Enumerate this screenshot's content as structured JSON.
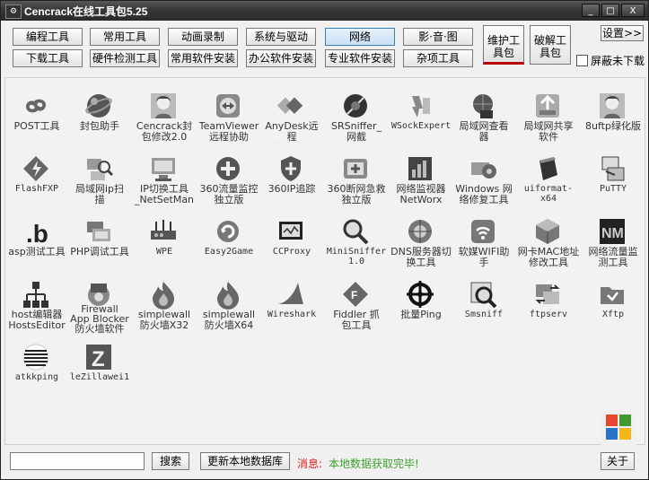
{
  "window": {
    "title": "Cencrack在线工具包5.25",
    "min": "_",
    "max": "□",
    "close": "X"
  },
  "toolbar": {
    "row1": [
      "编程工具",
      "常用工具",
      "动画录制",
      "系统与驱动",
      "网络",
      "影·音·图"
    ],
    "row2": [
      "下载工具",
      "硬件检测工具",
      "常用软件安装",
      "办公软件安装",
      "专业软件安装",
      "杂项工具"
    ],
    "big": [
      "维护工\n具包",
      "破解工\n具包"
    ],
    "settings": "设置>>",
    "hide_checkbox_label": "屏蔽未下载"
  },
  "items": [
    {
      "label": "POST工具",
      "icon": "link-icon"
    },
    {
      "label": "封包助手",
      "icon": "orb-icon"
    },
    {
      "label": "Cencrack封\n包修改2.0",
      "icon": "avatar-icon"
    },
    {
      "label": "TeamViewer\n远程协助",
      "icon": "teamviewer-icon"
    },
    {
      "label": "AnyDesk远程\n协助软件",
      "icon": "anydesk-icon"
    },
    {
      "label": "SRSniffer_\n网截",
      "icon": "sniffer-icon"
    },
    {
      "label": "WSockExpert",
      "icon": "wsock-icon"
    },
    {
      "label": "局域网查看\n器",
      "icon": "lan-icon"
    },
    {
      "label": "局域网共享\n软件",
      "icon": "share-icon"
    },
    {
      "label": "8uftp绿化版",
      "icon": "avatar-icon"
    },
    {
      "label": "FlashFXP",
      "icon": "flashfxp-icon"
    },
    {
      "label": "局域网ip扫\n描",
      "icon": "ipscan-icon"
    },
    {
      "label": "IP切换工具\n_NetSetMan",
      "icon": "netsetman-icon"
    },
    {
      "label": "360流量监控\n独立版",
      "icon": "plus-icon"
    },
    {
      "label": "360IP追踪",
      "icon": "shield-icon"
    },
    {
      "label": "360断网急救\n独立版",
      "icon": "firstaid-icon"
    },
    {
      "label": "网络监视器\nNetWorx",
      "icon": "chart-icon"
    },
    {
      "label": "Windows 网\n络修复工具",
      "icon": "repair-icon"
    },
    {
      "label": "uiformat-x64",
      "icon": "cylinder-icon"
    },
    {
      "label": "PuTTY",
      "icon": "putty-icon"
    },
    {
      "label": "asp测试工具",
      "icon": "b-icon"
    },
    {
      "label": "PHP调试工具",
      "icon": "server-icon"
    },
    {
      "label": "WPE",
      "icon": "router-icon"
    },
    {
      "label": "Easy2Game",
      "icon": "refresh-icon"
    },
    {
      "label": "CCProxy",
      "icon": "monitor-icon"
    },
    {
      "label": "MiniSniffer\n1.0",
      "icon": "magnifier-icon"
    },
    {
      "label": "DNS服务器切\n换工具",
      "icon": "dns-icon"
    },
    {
      "label": "软媒WIFI助\n手",
      "icon": "wifi-icon"
    },
    {
      "label": "网卡MAC地址\n修改工具",
      "icon": "cube-icon"
    },
    {
      "label": "网络流量监\n测工具",
      "icon": "nm-icon"
    },
    {
      "label": "host编辑器\nHostsEditor",
      "icon": "network-tree-icon"
    },
    {
      "label": "Firewall\nApp Blocker\n防火墙软件",
      "icon": "firewall-icon"
    },
    {
      "label": "simplewall\n防火墙X32",
      "icon": "flame-icon"
    },
    {
      "label": "simplewall\n防火墙X64",
      "icon": "flame-icon"
    },
    {
      "label": "Wireshark",
      "icon": "fin-icon"
    },
    {
      "label": "Fiddler 抓\n包工具",
      "icon": "fiddler-icon"
    },
    {
      "label": "批量Ping",
      "icon": "crosshair-icon"
    },
    {
      "label": "Smsniff",
      "icon": "smsniff-icon"
    },
    {
      "label": "ftpserv",
      "icon": "ftpserv-icon"
    },
    {
      "label": "Xftp",
      "icon": "xftp-icon"
    },
    {
      "label": "atkkping",
      "icon": "disc-icon"
    },
    {
      "label": "leZillawei1",
      "icon": "filezilla-icon"
    }
  ],
  "status": {
    "search_value": "",
    "search_button": "搜索",
    "update_button": "更新本地数据库",
    "msg_label": "消息:",
    "msg_text": "本地数据获取完毕!",
    "about_button": "关于"
  }
}
